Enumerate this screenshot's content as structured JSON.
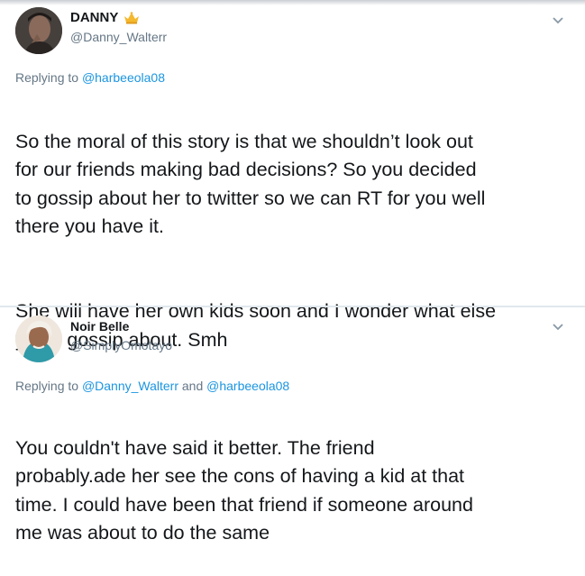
{
  "tweets": [
    {
      "display_name": "DANNY",
      "badge_icon": "crown-icon",
      "handle": "@Danny_Walterr",
      "replying_prefix": "Replying to",
      "replying_to": [
        "@harbeeola08"
      ],
      "replying_joiner": "",
      "paragraphs": [
        "So the moral of this story is that we shouldn’t look out\nfor our friends making bad decisions? So you decided\nto gossip about her to twitter so we can RT for you well\nthere you have it.",
        "She will have her own kids soon and I wonder what else\nyou’d gossip about. Smh"
      ],
      "menu_icon": "chevron-down-icon"
    },
    {
      "display_name": "Noir Belle",
      "handle": "@SimplyOmotayo",
      "replying_prefix": "Replying to",
      "replying_to": [
        "@Danny_Walterr",
        "@harbeeola08"
      ],
      "replying_joiner": "and",
      "paragraphs": [
        "You couldn't have said it better. The friend\nprobably.ade her see the cons of having a kid at that\ntime. I could have been that friend if someone around\nme was about to do the same"
      ],
      "menu_icon": "chevron-down-icon"
    }
  ],
  "colors": {
    "text": "#14171a",
    "secondary": "#657786",
    "link": "#1b95e0",
    "divider": "#e1e8ed",
    "badge": "#f5b82e"
  }
}
